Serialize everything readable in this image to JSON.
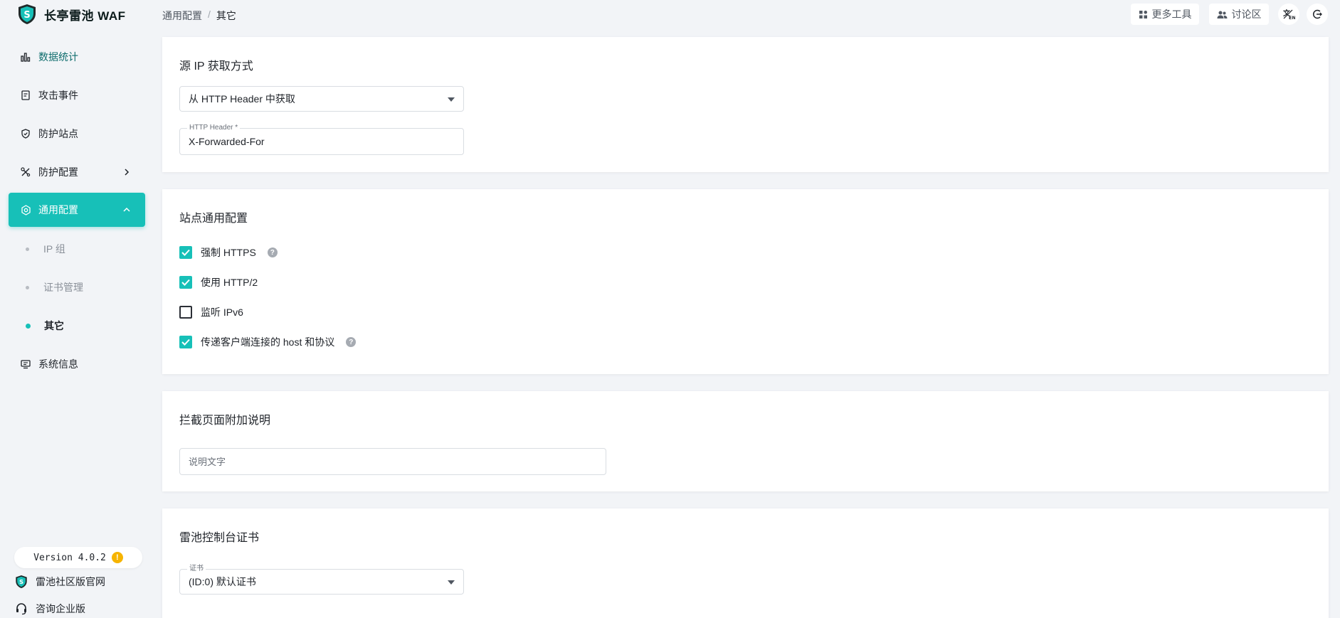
{
  "brand": {
    "title": "长亭雷池 WAF",
    "logo_icon": "shield-s-logo"
  },
  "colors": {
    "accent": "#17c0b8",
    "page_bg": "#f2f4f7"
  },
  "sidebar": {
    "items": [
      {
        "label": "数据统计",
        "icon": "bar-chart-icon"
      },
      {
        "label": "攻击事件",
        "icon": "document-icon"
      },
      {
        "label": "防护站点",
        "icon": "shield-icon"
      },
      {
        "label": "防护配置",
        "icon": "tools-icon"
      },
      {
        "label": "通用配置",
        "icon": "settings-icon"
      },
      {
        "label": "系统信息",
        "icon": "monitor-icon"
      }
    ],
    "sub_items": [
      {
        "label": "IP 组"
      },
      {
        "label": "证书管理"
      },
      {
        "label": "其它"
      }
    ]
  },
  "footer": {
    "version": "Version 4.0.2",
    "warn_glyph": "!",
    "links": [
      {
        "label": "雷池社区版官网",
        "icon": "shield-logo-icon"
      },
      {
        "label": "咨询企业版",
        "icon": "headset-icon"
      }
    ]
  },
  "breadcrumb": {
    "parent": "通用配置",
    "separator": "/",
    "current": "其它"
  },
  "header": {
    "more_tools": "更多工具",
    "forum": "讨论区",
    "lang_icon": "language-switch-icon",
    "logout_icon": "logout-icon"
  },
  "source_ip": {
    "title": "源 IP 获取方式",
    "select_value": "从 HTTP Header 中获取",
    "header_label": "HTTP Header *",
    "header_value": "X-Forwarded-For"
  },
  "site_config": {
    "title": "站点通用配置",
    "options": [
      {
        "label": "强制 HTTPS",
        "checked": true,
        "help": true
      },
      {
        "label": "使用 HTTP/2",
        "checked": true,
        "help": false
      },
      {
        "label": "监听 IPv6",
        "checked": false,
        "help": false
      },
      {
        "label": "传递客户端连接的 host 和协议",
        "checked": true,
        "help": true
      }
    ],
    "help_glyph": "?"
  },
  "block_page": {
    "title": "拦截页面附加说明",
    "placeholder": "说明文字"
  },
  "console_cert": {
    "title": "雷池控制台证书",
    "cert_label": "证书",
    "cert_value": "(ID:0) 默认证书"
  }
}
